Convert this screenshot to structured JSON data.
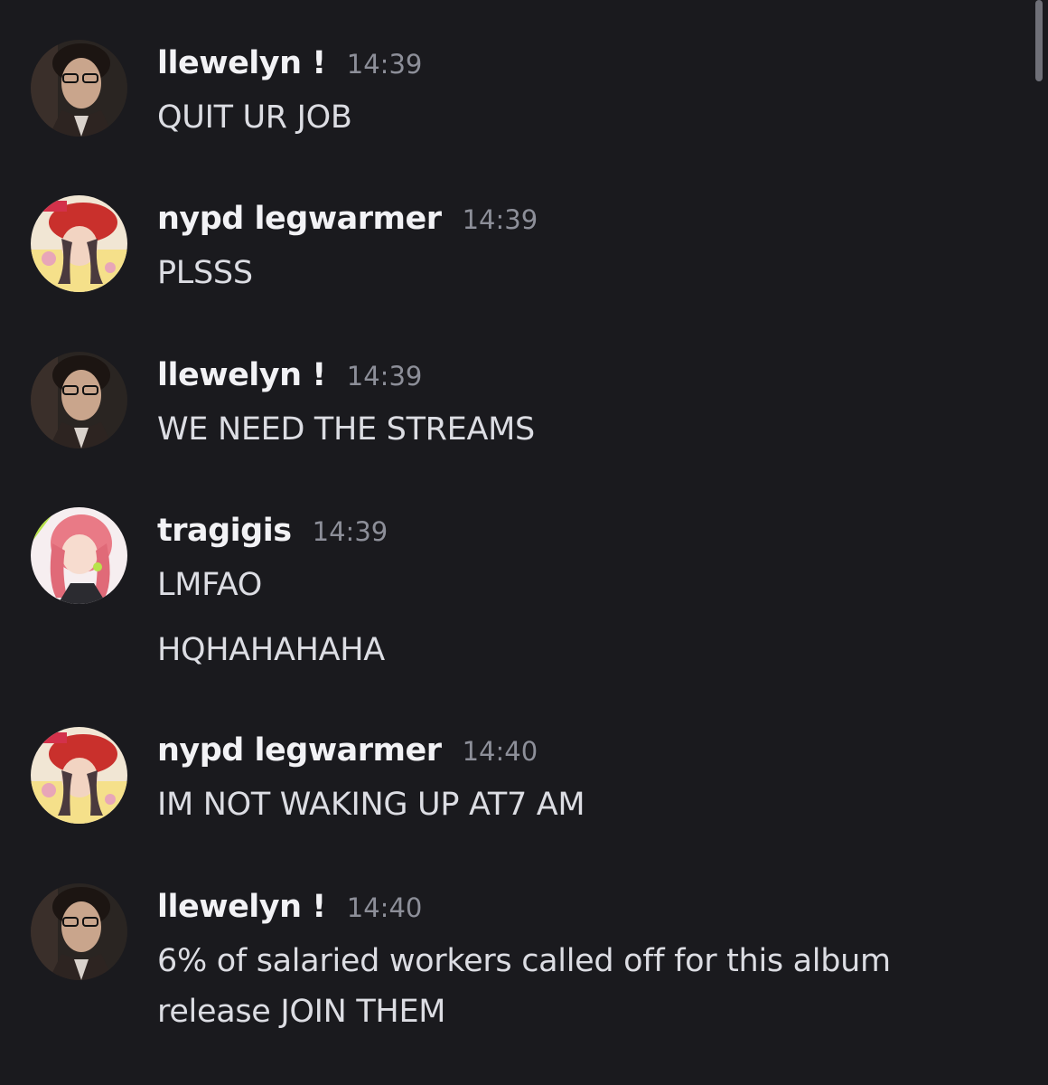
{
  "messages": [
    {
      "username": "llewelyn !",
      "time": "14:39",
      "lines": [
        "QUIT UR JOB"
      ],
      "avatar": "male-glasses-avatar"
    },
    {
      "username": "nypd legwarmer",
      "time": "14:39",
      "lines": [
        "PLSSS"
      ],
      "avatar": "anime-red-hat-avatar"
    },
    {
      "username": "llewelyn !",
      "time": "14:39",
      "lines": [
        "WE NEED THE STREAMS"
      ],
      "avatar": "male-glasses-avatar"
    },
    {
      "username": "tragigis",
      "time": "14:39",
      "lines": [
        "LMFAO",
        "HQHAHAHAHA"
      ],
      "avatar": "anime-pink-hair-avatar"
    },
    {
      "username": "nypd legwarmer",
      "time": "14:40",
      "lines": [
        "IM NOT WAKING UP AT7 AM"
      ],
      "avatar": "anime-red-hat-avatar"
    },
    {
      "username": "llewelyn !",
      "time": "14:40",
      "lines": [
        "6% of salaried workers called off for this album release JOIN THEM"
      ],
      "avatar": "male-glasses-avatar"
    }
  ],
  "colors": {
    "background": "#1a1a1e",
    "username": "#f2f2f5",
    "timestamp": "#8d8f99",
    "text": "#dcdde3"
  }
}
